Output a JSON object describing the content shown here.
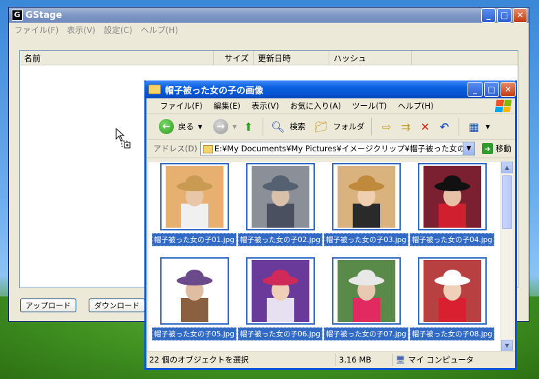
{
  "gstage": {
    "title": "GStage",
    "menu": [
      "ファイル(F)",
      "表示(V)",
      "設定(C)",
      "ヘルプ(H)"
    ],
    "columns": [
      "名前",
      "サイズ",
      "更新日時",
      "ハッシュ"
    ],
    "buttons": {
      "upload": "アップロード",
      "download": "ダウンロード"
    }
  },
  "explorer": {
    "title": "帽子被った女の子の画像",
    "menu": [
      "ファイル(F)",
      "編集(E)",
      "表示(V)",
      "お気に入り(A)",
      "ツール(T)",
      "ヘルプ(H)"
    ],
    "toolbar": {
      "back": "戻る",
      "search": "検索",
      "folders": "フォルダ"
    },
    "address_label": "アドレス(D)",
    "address_value": "E:¥My Documents¥My Pictures¥イメージクリップ¥帽子被った女の子の画像",
    "go_label": "移動",
    "files": [
      {
        "name": "帽子被った女の子01.jpg",
        "hat": "#c89a52",
        "bg": "#e8b070",
        "skin": "#e8c6a8",
        "top": "#f0f0f0"
      },
      {
        "name": "帽子被った女の子02.jpg",
        "hat": "#556070",
        "bg": "#8a8f98",
        "skin": "#d8c0aa",
        "top": "#4a5060"
      },
      {
        "name": "帽子被った女の子03.jpg",
        "hat": "#c08a3c",
        "bg": "#d9b27e",
        "skin": "#f0cfb0",
        "top": "#2a2a2a"
      },
      {
        "name": "帽子被った女の子04.jpg",
        "hat": "#111111",
        "bg": "#7a2030",
        "skin": "#e8c0a8",
        "top": "#d02030"
      },
      {
        "name": "帽子被った女の子05.jpg",
        "hat": "#6a4a8a",
        "bg": "#ffffff",
        "skin": "#e0bca0",
        "top": "#8a6040"
      },
      {
        "name": "帽子被った女の子06.jpg",
        "hat": "#d02a5a",
        "bg": "#6a3a9a",
        "skin": "#f0cfb8",
        "top": "#e6e0f0"
      },
      {
        "name": "帽子被った女の子07.jpg",
        "hat": "#e8e8e8",
        "bg": "#5a8a4a",
        "skin": "#e8c8b0",
        "top": "#e02a60"
      },
      {
        "name": "帽子被った女の子08.jpg",
        "hat": "#ffffff",
        "bg": "#b84040",
        "skin": "#f0d0b8",
        "top": "#d82030"
      }
    ],
    "status": {
      "count": "22 個のオブジェクトを選択",
      "size": "3.16 MB",
      "location": "マイ コンピュータ"
    }
  }
}
